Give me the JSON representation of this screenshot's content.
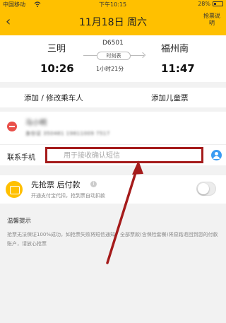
{
  "status_bar": {
    "carrier": "中国移动 ",
    "time": "下午10:15",
    "battery": "28%",
    "battery_level": 0.28
  },
  "nav": {
    "back_symbol": "‹",
    "title": "11月18日 周六",
    "right_action": "抢票说明"
  },
  "trip": {
    "departure_station": "三明",
    "arrival_station": "福州南",
    "train_number": "D6501",
    "schedule_label": "时刻表",
    "departure_time": "10:26",
    "arrival_time": "11:47",
    "duration": "1小时21分"
  },
  "passenger_actions": {
    "add_passenger": "添加 / 修改乘车人",
    "add_child": "添加儿童票"
  },
  "passenger": {
    "name": "马小明",
    "id_number": "身份证 350481 19811009 7517"
  },
  "contact": {
    "label": "联系手机",
    "placeholder": "用于接收确认短信",
    "value": ""
  },
  "prepay": {
    "title": "先抢票 后付款",
    "description": "开通支付宝代扣，抢到票自动扣款",
    "enabled": false
  },
  "tips": {
    "title": "温馨提示",
    "body": "抢票无法保证100%成功，如抢票失败将短信通知，全部票款(含保险套餐)将原路退回到您的付款账户，请放心抢票"
  },
  "colors": {
    "brand": "#ffc000",
    "danger": "#e9504a",
    "annotation": "#a51b1b",
    "contact_icon": "#3b9cf2"
  },
  "icons": {
    "wifi": "wifi-icon",
    "back": "back-arrow-icon",
    "remove": "remove-passenger-icon",
    "contact": "contact-book-icon",
    "wallet": "wallet-icon",
    "info": "info-icon"
  }
}
